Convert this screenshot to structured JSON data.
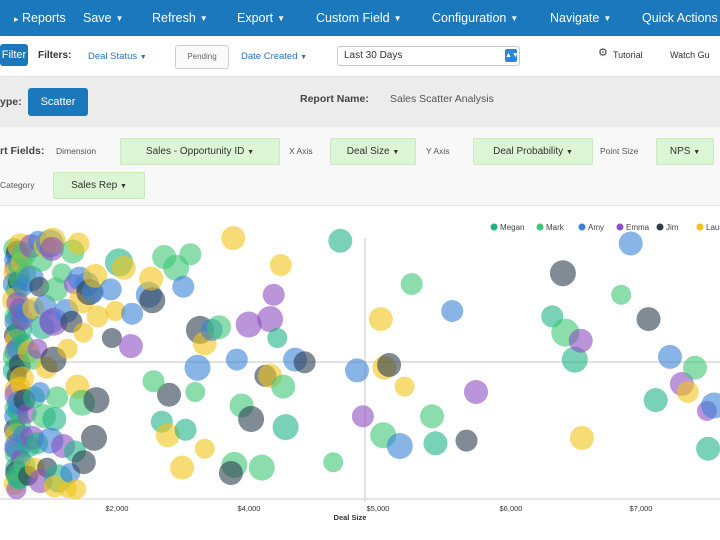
{
  "nav": {
    "items": [
      {
        "label": "Reports",
        "has_caret": false
      },
      {
        "label": "Save",
        "has_caret": true
      },
      {
        "label": "Refresh",
        "has_caret": true
      },
      {
        "label": "Export",
        "has_caret": true
      },
      {
        "label": "Custom Field",
        "has_caret": true
      },
      {
        "label": "Configuration",
        "has_caret": true
      },
      {
        "label": "Navigate",
        "has_caret": true
      },
      {
        "label": "Quick Actions",
        "has_caret": true
      }
    ]
  },
  "filters": {
    "filter_button": "Filter",
    "label": "Filters:",
    "deal_status": "Deal Status",
    "pending": "Pending",
    "date_created": "Date Created",
    "range_value": "Last 30 Days",
    "tutorial": "Tutorial",
    "watch": "Watch Gu"
  },
  "report_type": {
    "label": "ype:",
    "type_button": "Scatter",
    "name_label": "Report Name:",
    "name_value": "Sales Scatter Analysis"
  },
  "fields": {
    "label": "rt Fields:",
    "dimension_label": "Dimension",
    "dimension_value": "Sales - Opportunity ID",
    "xaxis_label": "X Axis",
    "xaxis_value": "Deal Size",
    "yaxis_label": "Y Axis",
    "yaxis_value": "Deal Probability",
    "pointsize_label": "Point Size",
    "pointsize_value": "NPS",
    "category_label": "Category",
    "category_value": "Sales Rep"
  },
  "chart_data": {
    "type": "scatter",
    "x_axis_title": "Deal Size",
    "x_ticks": [
      "$2,000",
      "$4,000",
      "$5,000",
      "$6,000",
      "$7,000"
    ],
    "legend": [
      {
        "name": "Megan",
        "color": "#1fb287"
      },
      {
        "name": "Mark",
        "color": "#3ec774"
      },
      {
        "name": "Amy",
        "color": "#3b82d6"
      },
      {
        "name": "Emma",
        "color": "#8e4fc2"
      },
      {
        "name": "Jim",
        "color": "#2b3e50"
      },
      {
        "name": "Laura",
        "color": "#f2c318"
      }
    ],
    "colors": [
      "#1fb287",
      "#3ec774",
      "#3b82d6",
      "#8e4fc2",
      "#2b3e50",
      "#f2c318"
    ],
    "points": [
      {
        "x": 6.0,
        "y": 93,
        "s": 11,
        "c": 1
      },
      {
        "x": 6.4,
        "y": 91,
        "s": 10,
        "c": 0
      },
      {
        "x": 6.8,
        "y": 89,
        "s": 12,
        "c": 2
      },
      {
        "x": 7.2,
        "y": 92,
        "s": 11,
        "c": 4
      },
      {
        "x": 6.1,
        "y": 86,
        "s": 10,
        "c": 3
      },
      {
        "x": 6.9,
        "y": 84,
        "s": 13,
        "c": 5
      },
      {
        "x": 7.4,
        "y": 87,
        "s": 10,
        "c": 1
      },
      {
        "x": 6.2,
        "y": 80,
        "s": 12,
        "c": 2
      },
      {
        "x": 7.0,
        "y": 78,
        "s": 11,
        "c": 0
      },
      {
        "x": 7.5,
        "y": 81,
        "s": 10,
        "c": 4
      },
      {
        "x": 6.4,
        "y": 74,
        "s": 13,
        "c": 5
      },
      {
        "x": 7.3,
        "y": 73,
        "s": 11,
        "c": 3
      },
      {
        "x": 6.1,
        "y": 68,
        "s": 10,
        "c": 1
      },
      {
        "x": 6.9,
        "y": 66,
        "s": 12,
        "c": 2
      },
      {
        "x": 7.6,
        "y": 69,
        "s": 10,
        "c": 0
      },
      {
        "x": 6.3,
        "y": 61,
        "s": 11,
        "c": 4
      },
      {
        "x": 7.1,
        "y": 59,
        "s": 12,
        "c": 5
      },
      {
        "x": 6.0,
        "y": 55,
        "s": 10,
        "c": 3
      },
      {
        "x": 6.7,
        "y": 53,
        "s": 13,
        "c": 1
      },
      {
        "x": 7.4,
        "y": 56,
        "s": 11,
        "c": 2
      },
      {
        "x": 6.2,
        "y": 48,
        "s": 12,
        "c": 0
      },
      {
        "x": 7.0,
        "y": 46,
        "s": 10,
        "c": 4
      },
      {
        "x": 6.5,
        "y": 41,
        "s": 11,
        "c": 5
      },
      {
        "x": 7.3,
        "y": 39,
        "s": 13,
        "c": 3
      },
      {
        "x": 6.1,
        "y": 34,
        "s": 10,
        "c": 1
      },
      {
        "x": 6.8,
        "y": 31,
        "s": 12,
        "c": 2
      },
      {
        "x": 7.5,
        "y": 33,
        "s": 10,
        "c": 0
      },
      {
        "x": 6.3,
        "y": 26,
        "s": 11,
        "c": 4
      },
      {
        "x": 7.1,
        "y": 24,
        "s": 12,
        "c": 5
      },
      {
        "x": 6.0,
        "y": 19,
        "s": 10,
        "c": 3
      },
      {
        "x": 6.7,
        "y": 17,
        "s": 11,
        "c": 1
      },
      {
        "x": 7.4,
        "y": 20,
        "s": 13,
        "c": 2
      },
      {
        "x": 6.4,
        "y": 12,
        "s": 10,
        "c": 0
      },
      {
        "x": 7.2,
        "y": 10,
        "s": 12,
        "c": 4
      },
      {
        "x": 6.1,
        "y": 6,
        "s": 11,
        "c": 5
      },
      {
        "x": 6.9,
        "y": 4,
        "s": 10,
        "c": 3
      },
      {
        "x": 7.7,
        "y": 8,
        "s": 11,
        "c": 1
      },
      {
        "x": 7.9,
        "y": 90,
        "s": 12,
        "c": 2
      },
      {
        "x": 8.2,
        "y": 82,
        "s": 11,
        "c": 1
      },
      {
        "x": 8.6,
        "y": 94,
        "s": 13,
        "c": 5
      },
      {
        "x": 8.1,
        "y": 71,
        "s": 10,
        "c": 3
      },
      {
        "x": 8.5,
        "y": 63,
        "s": 12,
        "c": 0
      },
      {
        "x": 8.3,
        "y": 50,
        "s": 11,
        "c": 4
      },
      {
        "x": 8.7,
        "y": 42,
        "s": 10,
        "c": 5
      },
      {
        "x": 8.0,
        "y": 36,
        "s": 12,
        "c": 2
      },
      {
        "x": 8.4,
        "y": 28,
        "s": 11,
        "c": 1
      },
      {
        "x": 8.8,
        "y": 15,
        "s": 10,
        "c": 3
      },
      {
        "x": 8.2,
        "y": 9,
        "s": 13,
        "c": 0
      },
      {
        "x": 9.1,
        "y": 88,
        "s": 11,
        "c": 5
      },
      {
        "x": 9.6,
        "y": 79,
        "s": 10,
        "c": 2
      },
      {
        "x": 10.1,
        "y": 91,
        "s": 12,
        "c": 1
      },
      {
        "x": 9.3,
        "y": 67,
        "s": 11,
        "c": 3
      },
      {
        "x": 9.9,
        "y": 58,
        "s": 10,
        "c": 0
      },
      {
        "x": 9.2,
        "y": 45,
        "s": 12,
        "c": 5
      },
      {
        "x": 10.3,
        "y": 37,
        "s": 11,
        "c": 4
      },
      {
        "x": 9.7,
        "y": 24,
        "s": 10,
        "c": 2
      },
      {
        "x": 10.2,
        "y": 13,
        "s": 11,
        "c": 1
      },
      {
        "x": 11.0,
        "y": 84,
        "s": 10,
        "c": 1
      },
      {
        "x": 11.5,
        "y": 70,
        "s": 12,
        "c": 2
      },
      {
        "x": 12.0,
        "y": 55,
        "s": 11,
        "c": 5
      },
      {
        "x": 11.2,
        "y": 32,
        "s": 10,
        "c": 3
      },
      {
        "x": 12.3,
        "y": 20,
        "s": 11,
        "c": 0
      },
      {
        "x": 11.8,
        "y": 9,
        "s": 10,
        "c": 4
      },
      {
        "x": 13.2,
        "y": 94,
        "s": 12,
        "c": 3
      },
      {
        "x": 13.0,
        "y": 82,
        "s": 13,
        "c": 2
      },
      {
        "x": 14.0,
        "y": 71,
        "s": 11,
        "c": 5
      },
      {
        "x": 13.7,
        "y": 52,
        "s": 10,
        "c": 1
      },
      {
        "x": 14.3,
        "y": 38,
        "s": 11,
        "c": 0
      },
      {
        "x": 13.5,
        "y": 23,
        "s": 12,
        "c": 3
      },
      {
        "x": 14.6,
        "y": 12,
        "s": 10,
        "c": 5
      },
      {
        "x": 16.0,
        "y": 96,
        "s": 10,
        "c": 2
      },
      {
        "x": 17.2,
        "y": 89,
        "s": 12,
        "c": 1
      },
      {
        "x": 18.8,
        "y": 94,
        "s": 11,
        "c": 5
      },
      {
        "x": 16.5,
        "y": 79,
        "s": 10,
        "c": 4
      },
      {
        "x": 19.0,
        "y": 72,
        "s": 11,
        "c": 2
      },
      {
        "x": 17.8,
        "y": 64,
        "s": 12,
        "c": 0
      },
      {
        "x": 15.8,
        "y": 56,
        "s": 10,
        "c": 3
      },
      {
        "x": 19.6,
        "y": 49,
        "s": 11,
        "c": 5
      },
      {
        "x": 16.8,
        "y": 40,
        "s": 10,
        "c": 2
      },
      {
        "x": 18.5,
        "y": 31,
        "s": 12,
        "c": 1
      },
      {
        "x": 15.6,
        "y": 21,
        "s": 11,
        "c": 0
      },
      {
        "x": 19.8,
        "y": 12,
        "s": 10,
        "c": 4
      },
      {
        "x": 17.0,
        "y": 7,
        "s": 12,
        "c": 3
      },
      {
        "x": 21.0,
        "y": 95,
        "s": 14,
        "c": 2
      },
      {
        "x": 22.2,
        "y": 96,
        "s": 13,
        "c": 5
      },
      {
        "x": 21.8,
        "y": 93,
        "s": 12,
        "c": 3
      },
      {
        "x": 23.5,
        "y": 78,
        "s": 12,
        "c": 1
      },
      {
        "x": 21.5,
        "y": 66,
        "s": 12,
        "c": 2
      },
      {
        "x": 22.5,
        "y": 66,
        "s": 14,
        "c": 3
      },
      {
        "x": 22.5,
        "y": 52,
        "s": 13,
        "c": 4
      },
      {
        "x": 24.0,
        "y": 38,
        "s": 11,
        "c": 1
      },
      {
        "x": 22.8,
        "y": 30,
        "s": 12,
        "c": 0
      },
      {
        "x": 21.2,
        "y": 22,
        "s": 13,
        "c": 2
      },
      {
        "x": 24.6,
        "y": 8,
        "s": 14,
        "c": 0
      },
      {
        "x": 23.0,
        "y": 5,
        "s": 11,
        "c": 5
      },
      {
        "x": 26.0,
        "y": 84,
        "s": 10,
        "c": 1
      },
      {
        "x": 27.8,
        "y": 70,
        "s": 12,
        "c": 2
      },
      {
        "x": 28.4,
        "y": 56,
        "s": 10,
        "c": 5
      },
      {
        "x": 26.5,
        "y": 20,
        "s": 12,
        "c": 3
      },
      {
        "x": 28.5,
        "y": 4,
        "s": 9,
        "c": 5
      },
      {
        "x": 29.5,
        "y": 10,
        "s": 10,
        "c": 2
      },
      {
        "x": 30.5,
        "y": 92,
        "s": 12,
        "c": 1
      },
      {
        "x": 31.0,
        "y": 80,
        "s": 10,
        "c": 3
      },
      {
        "x": 30.0,
        "y": 66,
        "s": 11,
        "c": 4
      },
      {
        "x": 32.5,
        "y": 42,
        "s": 12,
        "c": 5
      },
      {
        "x": 31.5,
        "y": 18,
        "s": 11,
        "c": 0
      },
      {
        "x": 32.0,
        "y": 4,
        "s": 10,
        "c": 5
      },
      {
        "x": 33.0,
        "y": 95,
        "s": 11,
        "c": 5
      },
      {
        "x": 33.5,
        "y": 82,
        "s": 12,
        "c": 2
      },
      {
        "x": 34.5,
        "y": 74,
        "s": 13,
        "c": 5
      },
      {
        "x": 35.0,
        "y": 62,
        "s": 10,
        "c": 5
      },
      {
        "x": 34.5,
        "y": 36,
        "s": 13,
        "c": 1
      },
      {
        "x": 35.2,
        "y": 14,
        "s": 12,
        "c": 4
      },
      {
        "x": 36.5,
        "y": 80,
        "s": 12,
        "c": 2
      },
      {
        "x": 37.5,
        "y": 77,
        "s": 13,
        "c": 4
      },
      {
        "x": 39.0,
        "y": 77,
        "s": 11,
        "c": 2
      },
      {
        "x": 41.0,
        "y": 68,
        "s": 11,
        "c": 5
      },
      {
        "x": 40.5,
        "y": 37,
        "s": 13,
        "c": 4
      },
      {
        "x": 39.5,
        "y": 23,
        "s": 13,
        "c": 4
      },
      {
        "x": 40.0,
        "y": 83,
        "s": 12,
        "c": 5
      },
      {
        "x": 46.5,
        "y": 78,
        "s": 11,
        "c": 2
      },
      {
        "x": 47.0,
        "y": 60,
        "s": 10,
        "c": 4
      },
      {
        "x": 48.5,
        "y": 70,
        "s": 10,
        "c": 5
      },
      {
        "x": 50.0,
        "y": 88,
        "s": 14,
        "c": 0
      },
      {
        "x": 52.0,
        "y": 86,
        "s": 12,
        "c": 5
      },
      {
        "x": 55.0,
        "y": 57,
        "s": 12,
        "c": 3
      },
      {
        "x": 55.5,
        "y": 69,
        "s": 11,
        "c": 2
      },
      {
        "x": 62.5,
        "y": 76,
        "s": 13,
        "c": 2
      },
      {
        "x": 64.0,
        "y": 74,
        "s": 13,
        "c": 4
      },
      {
        "x": 63.5,
        "y": 82,
        "s": 12,
        "c": 5
      },
      {
        "x": 68.0,
        "y": 29,
        "s": 11,
        "c": 0
      },
      {
        "x": 70.5,
        "y": 24,
        "s": 12,
        "c": 5
      },
      {
        "x": 71.0,
        "y": 39,
        "s": 12,
        "c": 4
      },
      {
        "x": 64.5,
        "y": 44,
        "s": 11,
        "c": 1
      },
      {
        "x": 69.0,
        "y": 90,
        "s": 12,
        "c": 1
      },
      {
        "x": 74.0,
        "y": 86,
        "s": 13,
        "c": 1
      },
      {
        "x": 77.0,
        "y": 79,
        "s": 11,
        "c": 2
      },
      {
        "x": 80.0,
        "y": 91,
        "s": 11,
        "c": 1
      },
      {
        "x": 84.0,
        "y": 63,
        "s": 14,
        "c": 4
      },
      {
        "x": 83.0,
        "y": 49,
        "s": 13,
        "c": 2
      },
      {
        "x": 82.0,
        "y": 40,
        "s": 10,
        "c": 1
      },
      {
        "x": 78.0,
        "y": 26,
        "s": 11,
        "c": 0
      },
      {
        "x": 76.5,
        "y": 12,
        "s": 12,
        "c": 5
      },
      {
        "x": 86.0,
        "y": 58,
        "s": 12,
        "c": 5
      },
      {
        "x": 89.0,
        "y": 63,
        "s": 11,
        "c": 2
      },
      {
        "x": 92.0,
        "y": 64,
        "s": 12,
        "c": 1
      },
      {
        "x": 98.0,
        "y": 97,
        "s": 12,
        "c": 5
      },
      {
        "x": 104.5,
        "y": 65,
        "s": 13,
        "c": 3
      },
      {
        "x": 101.5,
        "y": 35,
        "s": 12,
        "c": 1
      },
      {
        "x": 98.5,
        "y": 13,
        "s": 13,
        "c": 1
      },
      {
        "x": 97.0,
        "y": 10,
        "s": 12,
        "c": 4
      },
      {
        "x": 86.0,
        "y": 19,
        "s": 10,
        "c": 5
      },
      {
        "x": 99.5,
        "y": 52,
        "s": 11,
        "c": 2
      },
      {
        "x": 105.5,
        "y": 30,
        "s": 13,
        "c": 4
      },
      {
        "x": 110.0,
        "y": 12,
        "s": 13,
        "c": 1
      },
      {
        "x": 111.5,
        "y": 46,
        "s": 11,
        "c": 4
      },
      {
        "x": 113.5,
        "y": 46,
        "s": 12,
        "c": 5
      },
      {
        "x": 113.5,
        "y": 67,
        "s": 13,
        "c": 3
      },
      {
        "x": 119.0,
        "y": 42,
        "s": 12,
        "c": 1
      },
      {
        "x": 120.0,
        "y": 27,
        "s": 13,
        "c": 0
      },
      {
        "x": 118.0,
        "y": 87,
        "s": 11,
        "c": 5
      },
      {
        "x": 116.5,
        "y": 60,
        "s": 10,
        "c": 0
      },
      {
        "x": 115.0,
        "y": 76,
        "s": 11,
        "c": 3
      },
      {
        "x": 124.0,
        "y": 52,
        "s": 12,
        "c": 2
      },
      {
        "x": 128.0,
        "y": 51,
        "s": 11,
        "c": 4
      },
      {
        "x": 140.0,
        "y": 14,
        "s": 10,
        "c": 1
      },
      {
        "x": 143.0,
        "y": 96,
        "s": 12,
        "c": 0
      },
      {
        "x": 150.0,
        "y": 48,
        "s": 12,
        "c": 2
      },
      {
        "x": 152.5,
        "y": 31,
        "s": 11,
        "c": 3
      },
      {
        "x": 160.0,
        "y": 67,
        "s": 12,
        "c": 5
      },
      {
        "x": 161.5,
        "y": 49,
        "s": 12,
        "c": 5
      },
      {
        "x": 163.5,
        "y": 50,
        "s": 12,
        "c": 4
      },
      {
        "x": 161.0,
        "y": 24,
        "s": 13,
        "c": 1
      },
      {
        "x": 168.0,
        "y": 20,
        "s": 13,
        "c": 2
      },
      {
        "x": 170.0,
        "y": 42,
        "s": 10,
        "c": 5
      },
      {
        "x": 173.0,
        "y": 80,
        "s": 11,
        "c": 1
      },
      {
        "x": 183.0,
        "y": 21,
        "s": 12,
        "c": 0
      },
      {
        "x": 181.5,
        "y": 31,
        "s": 12,
        "c": 1
      },
      {
        "x": 190.0,
        "y": 70,
        "s": 11,
        "c": 2
      },
      {
        "x": 196.0,
        "y": 22,
        "s": 11,
        "c": 4
      },
      {
        "x": 200.0,
        "y": 40,
        "s": 12,
        "c": 3
      },
      {
        "x": 232.0,
        "y": 68,
        "s": 11,
        "c": 0
      },
      {
        "x": 236.5,
        "y": 84,
        "s": 13,
        "c": 4
      },
      {
        "x": 237.5,
        "y": 62,
        "s": 14,
        "c": 1
      },
      {
        "x": 241.5,
        "y": 52,
        "s": 13,
        "c": 0
      },
      {
        "x": 244.0,
        "y": 59,
        "s": 12,
        "c": 3
      },
      {
        "x": 244.5,
        "y": 23,
        "s": 12,
        "c": 5
      },
      {
        "x": 265.0,
        "y": 95,
        "s": 12,
        "c": 2
      },
      {
        "x": 261.0,
        "y": 76,
        "s": 10,
        "c": 1
      },
      {
        "x": 272.5,
        "y": 67,
        "s": 12,
        "c": 4
      },
      {
        "x": 281.5,
        "y": 53,
        "s": 12,
        "c": 2
      },
      {
        "x": 275.5,
        "y": 37,
        "s": 12,
        "c": 0
      },
      {
        "x": 286.5,
        "y": 43,
        "s": 12,
        "c": 3
      },
      {
        "x": 289.0,
        "y": 40,
        "s": 11,
        "c": 5
      },
      {
        "x": 292.0,
        "y": 49,
        "s": 12,
        "c": 1
      },
      {
        "x": 297.0,
        "y": 33,
        "s": 10,
        "c": 3
      },
      {
        "x": 297.5,
        "y": 19,
        "s": 12,
        "c": 0
      },
      {
        "x": 300.0,
        "y": 35,
        "s": 13,
        "c": 2
      }
    ]
  }
}
